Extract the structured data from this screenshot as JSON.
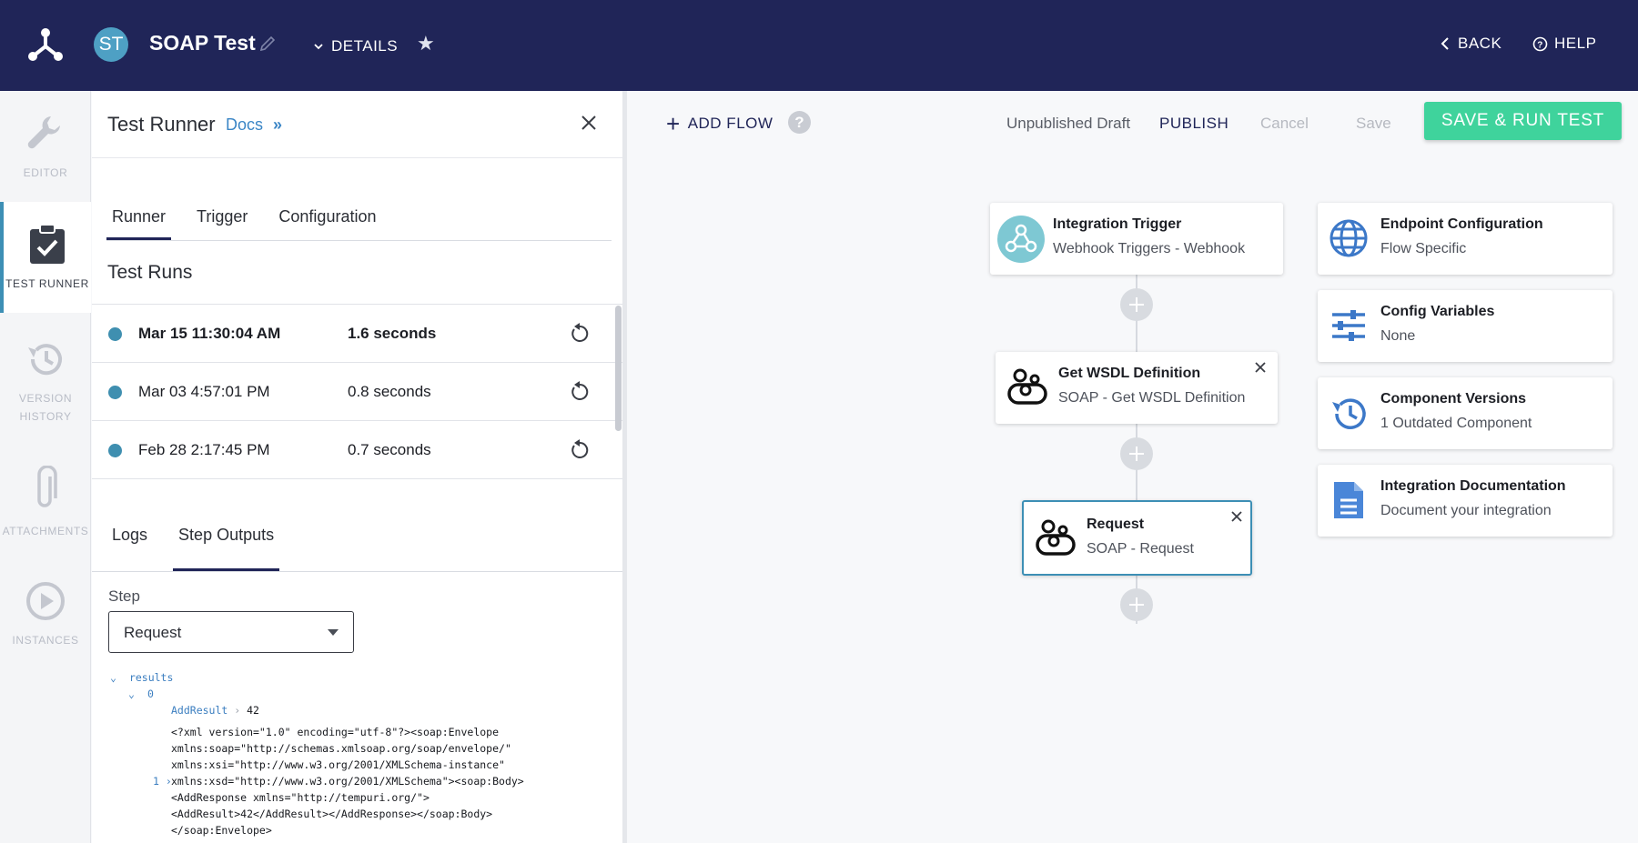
{
  "header": {
    "avatar_initials": "ST",
    "title": "SOAP Test",
    "details_label": "DETAILS",
    "back_label": "BACK",
    "help_label": "HELP"
  },
  "nav": {
    "items": [
      {
        "label": "EDITOR",
        "icon": "wrench-icon"
      },
      {
        "label": "TEST RUNNER",
        "icon": "clipboard-check-icon"
      },
      {
        "label": "VERSION HISTORY",
        "icon": "history-icon"
      },
      {
        "label": "ATTACHMENTS",
        "icon": "paperclip-icon"
      },
      {
        "label": "INSTANCES",
        "icon": "play-circle-icon"
      }
    ]
  },
  "panel": {
    "title": "Test Runner",
    "docs_label": "Docs",
    "tabs": [
      "Runner",
      "Trigger",
      "Configuration"
    ],
    "runs_title": "Test Runs",
    "runs": [
      {
        "date": "Mar 15 11:30:04 AM",
        "duration": "1.6 seconds"
      },
      {
        "date": "Mar 03 4:57:01 PM",
        "duration": "0.8 seconds"
      },
      {
        "date": "Feb 28 2:17:45 PM",
        "duration": "0.7 seconds"
      }
    ],
    "output_tabs": [
      "Logs",
      "Step Outputs"
    ],
    "step_label": "Step",
    "step_value": "Request",
    "tree": {
      "root_key": "results",
      "index_key": "0",
      "result_key": "AddResult",
      "result_value": "42",
      "line_index": "1",
      "xml_lines": [
        "<?xml version=\"1.0\" encoding=\"utf-8\"?><soap:Envelope",
        "xmlns:soap=\"http://schemas.xmlsoap.org/soap/envelope/\"",
        "xmlns:xsi=\"http://www.w3.org/2001/XMLSchema-instance\"",
        "xmlns:xsd=\"http://www.w3.org/2001/XMLSchema\"><soap:Body>",
        "<AddResponse xmlns=\"http://tempuri.org/\">",
        "<AddResult>42</AddResult></AddResponse></soap:Body>",
        "</soap:Envelope>"
      ]
    }
  },
  "canvas": {
    "add_flow_label": "ADD FLOW",
    "help_mark": "?",
    "draft_label": "Unpublished Draft",
    "publish_label": "PUBLISH",
    "cancel_label": "Cancel",
    "save_label": "Save",
    "save_run_label": "SAVE & RUN TEST",
    "steps": [
      {
        "title": "Integration Trigger",
        "subtitle": "Webhook Triggers - Webhook"
      },
      {
        "title": "Get WSDL Definition",
        "subtitle": "SOAP - Get WSDL Definition"
      },
      {
        "title": "Request",
        "subtitle": "SOAP - Request"
      }
    ],
    "info_cards": [
      {
        "title": "Endpoint Configuration",
        "subtitle": "Flow Specific"
      },
      {
        "title": "Config Variables",
        "subtitle": "None"
      },
      {
        "title": "Component Versions",
        "subtitle": "1 Outdated Component"
      },
      {
        "title": "Integration Documentation",
        "subtitle": "Document your integration"
      }
    ]
  },
  "colors": {
    "header_bg": "#202558",
    "accent": "#3d8fb5",
    "save_run_bg": "#3fd39c",
    "link": "#3b86c6"
  }
}
